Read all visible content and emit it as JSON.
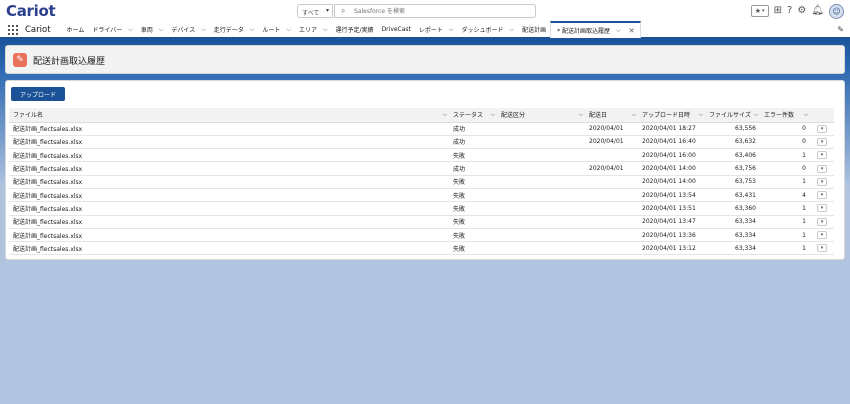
{
  "app": {
    "logo": "Cariot",
    "app_name": "Cariot"
  },
  "search": {
    "scope": "すべて",
    "placeholder": "Salesforce を検索"
  },
  "nav": {
    "items": [
      {
        "label": "ホーム",
        "has_menu": false
      },
      {
        "label": "ドライバー",
        "has_menu": true
      },
      {
        "label": "車両",
        "has_menu": true
      },
      {
        "label": "デバイス",
        "has_menu": true
      },
      {
        "label": "走行データ",
        "has_menu": true
      },
      {
        "label": "ルート",
        "has_menu": true
      },
      {
        "label": "エリア",
        "has_menu": true
      },
      {
        "label": "運行予定/実績",
        "has_menu": false
      },
      {
        "label": "DriveCast",
        "has_menu": false
      },
      {
        "label": "レポート",
        "has_menu": true
      },
      {
        "label": "ダッシュボード",
        "has_menu": true
      },
      {
        "label": "配送計画",
        "has_menu": false
      }
    ],
    "active_tab": "* 配送計画取込履歴"
  },
  "page": {
    "title": "配送計画取込履歴",
    "upload_label": "アップロード"
  },
  "table": {
    "columns": [
      "ファイル名",
      "ステータス",
      "配送区分",
      "配送日",
      "アップロード日時",
      "ファイルサイズ",
      "エラー件数"
    ],
    "rows": [
      {
        "file": "配送計画_flectsales.xlsx",
        "status": "成功",
        "category": "",
        "date": "2020/04/01",
        "uploaded": "2020/04/01 18:27",
        "size": "63,556",
        "errors": "0"
      },
      {
        "file": "配送計画_flectsales.xlsx",
        "status": "成功",
        "category": "",
        "date": "2020/04/01",
        "uploaded": "2020/04/01 16:40",
        "size": "63,632",
        "errors": "0"
      },
      {
        "file": "配送計画_flectsales.xlsx",
        "status": "失敗",
        "category": "",
        "date": "",
        "uploaded": "2020/04/01 16:00",
        "size": "63,406",
        "errors": "1"
      },
      {
        "file": "配送計画_flectsales.xlsx",
        "status": "成功",
        "category": "",
        "date": "2020/04/01",
        "uploaded": "2020/04/01 14:00",
        "size": "63,756",
        "errors": "0"
      },
      {
        "file": "配送計画_flectsales.xlsx",
        "status": "失敗",
        "category": "",
        "date": "",
        "uploaded": "2020/04/01 14:00",
        "size": "63,753",
        "errors": "1"
      },
      {
        "file": "配送計画_flectsales.xlsx",
        "status": "失敗",
        "category": "",
        "date": "",
        "uploaded": "2020/04/01 13:54",
        "size": "63,431",
        "errors": "4"
      },
      {
        "file": "配送計画_flectsales.xlsx",
        "status": "失敗",
        "category": "",
        "date": "",
        "uploaded": "2020/04/01 13:51",
        "size": "63,360",
        "errors": "1"
      },
      {
        "file": "配送計画_flectsales.xlsx",
        "status": "失敗",
        "category": "",
        "date": "",
        "uploaded": "2020/04/01 13:47",
        "size": "63,334",
        "errors": "1"
      },
      {
        "file": "配送計画_flectsales.xlsx",
        "status": "失敗",
        "category": "",
        "date": "",
        "uploaded": "2020/04/01 13:36",
        "size": "63,334",
        "errors": "1"
      },
      {
        "file": "配送計画_flectsales.xlsx",
        "status": "失敗",
        "category": "",
        "date": "",
        "uploaded": "2020/04/01 13:12",
        "size": "63,334",
        "errors": "1"
      }
    ]
  },
  "icons": {
    "header": "pencil-icon",
    "utility": [
      "star-icon",
      "add-icon",
      "help-icon",
      "setup-gear-icon",
      "notification-bell-icon"
    ]
  },
  "colors": {
    "brand": "#1b5297",
    "header_icon": "#e8735a",
    "logo": "#2b3f8e"
  }
}
